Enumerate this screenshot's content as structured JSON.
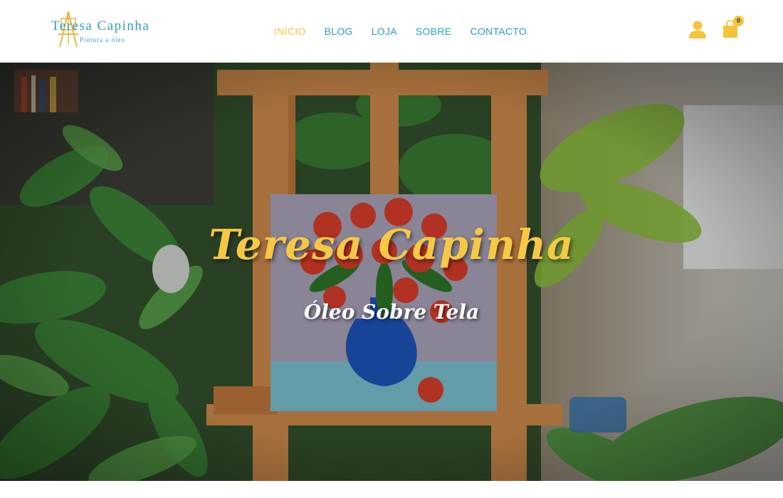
{
  "brand": {
    "title": "Teresa Capinha",
    "subtitle": "Pintura a óleo"
  },
  "nav": {
    "items": [
      {
        "label": "INÍCIO",
        "active": true
      },
      {
        "label": "BLOG",
        "active": false
      },
      {
        "label": "LOJA",
        "active": false
      },
      {
        "label": "SOBRE",
        "active": false
      },
      {
        "label": "CONTACTO",
        "active": false
      }
    ]
  },
  "header_icons": {
    "user_icon": "user-icon",
    "cart_icon": "shopping-bag-icon",
    "cart_count": "0"
  },
  "hero": {
    "title": "Teresa Capinha",
    "subtitle": "Óleo Sobre Tela",
    "image_subject": "easel with red poppy painting among plants"
  },
  "colors": {
    "brand_teal": "#2a9fb8",
    "accent_yellow": "#f3c43c",
    "hero_title": "#f7c844",
    "hero_subtitle": "#ffffff"
  }
}
